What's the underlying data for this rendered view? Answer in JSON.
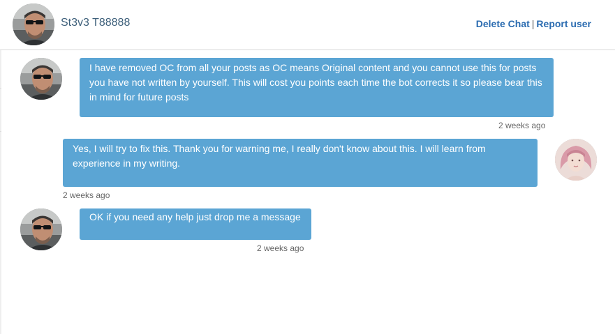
{
  "header": {
    "username": "St3v3 T88888",
    "delete_chat_label": "Delete Chat",
    "separator": "|",
    "report_user_label": "Report user"
  },
  "messages": [
    {
      "sender": "other",
      "text": "I have removed OC from all your posts as OC means Original content and you cannot use this for posts you have not written by yourself. This will cost you points each time the bot corrects it so please bear this in mind for future posts",
      "time": "2 weeks ago"
    },
    {
      "sender": "self",
      "text": "Yes, I will try to fix this. Thank you for warning me, I really don't know about this. I will learn from experience in my writing.",
      "time": "2 weeks ago"
    },
    {
      "sender": "other",
      "text": "OK if you need any help just drop me a message",
      "time": "2 weeks ago"
    }
  ],
  "colors": {
    "bubble": "#5ba5d4",
    "link": "#2a6bb0",
    "username": "#3d5f7a",
    "timestamp": "#666666"
  },
  "icons": {
    "other_avatar": "avatar-man-sunglasses",
    "self_avatar": "avatar-woman-pink-hair"
  }
}
